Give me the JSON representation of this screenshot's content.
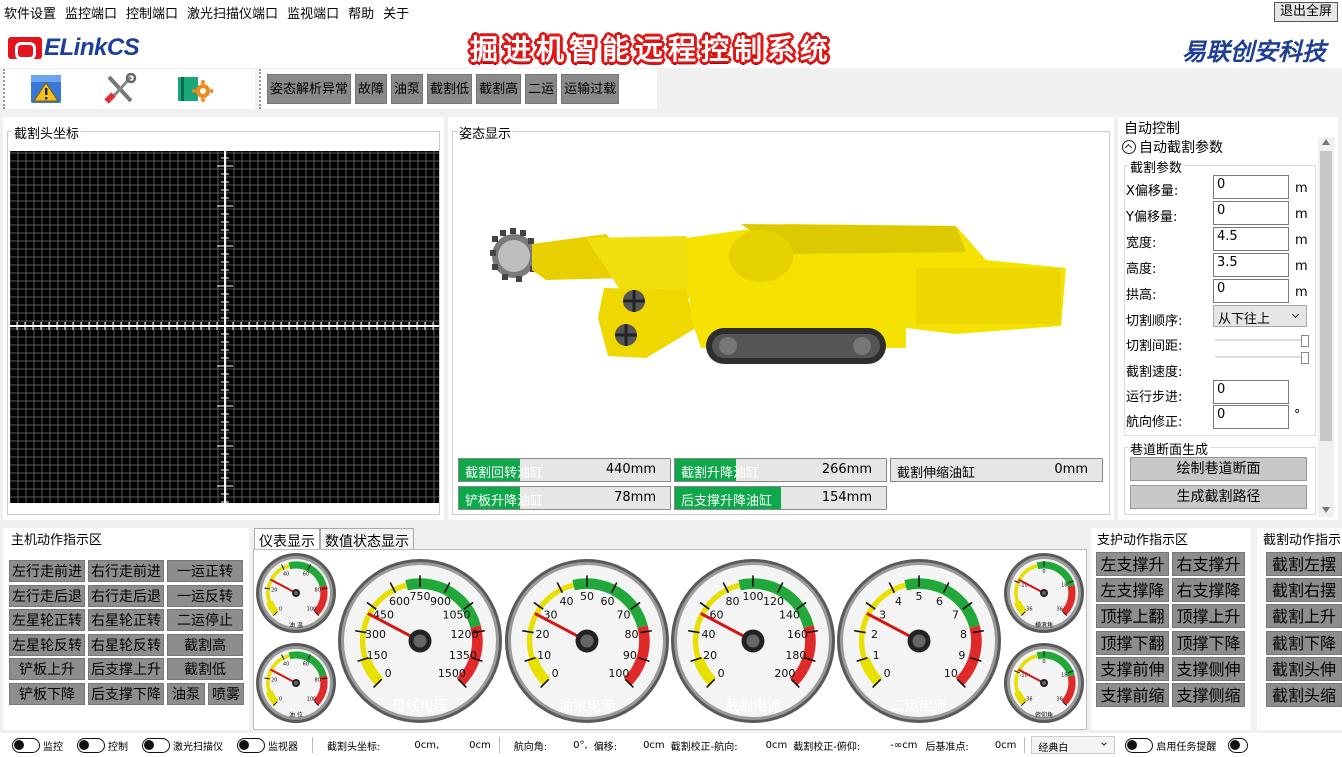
{
  "menu": [
    "软件设置",
    "监控端口",
    "控制端口",
    "激光扫描仪端口",
    "监视端口",
    "帮助",
    "关于"
  ],
  "exit_label": "退出全屏",
  "logo_text": "ELinkCS",
  "app_title": "掘进机智能远程控制系统",
  "brand": "易联创安科技",
  "toolbar_icons": [
    "warning-icon",
    "tools-icon",
    "book-gear-icon"
  ],
  "alarms": [
    "姿态解析异常",
    "故障",
    "油泵",
    "截割低",
    "截割高",
    "二运",
    "运输过载"
  ],
  "coord_panel_title": "截割头坐标",
  "attitude_panel_title": "姿态显示",
  "cylinders": [
    {
      "label": "截割回转油缸",
      "value": "440mm",
      "fill": 0.29
    },
    {
      "label": "截割升降油缸",
      "value": "266mm",
      "fill": 0.29
    },
    {
      "label": "截割伸缩油缸",
      "value": "0mm",
      "fill": 0
    },
    {
      "label": "铲板升降油缸",
      "value": "78mm",
      "fill": 0.29
    },
    {
      "label": "后支撑升降油缸",
      "value": "154mm",
      "fill": 0.5
    }
  ],
  "auto": {
    "title": "自动控制",
    "section": "自动截割参数",
    "group": "截割参数",
    "fields": [
      {
        "label": "X偏移量:",
        "value": "0",
        "unit": "m"
      },
      {
        "label": "Y偏移量:",
        "value": "0",
        "unit": "m"
      },
      {
        "label": "宽度:",
        "value": "4.5",
        "unit": "m"
      },
      {
        "label": "高度:",
        "value": "3.5",
        "unit": "m"
      },
      {
        "label": "拱高:",
        "value": "0",
        "unit": "m"
      }
    ],
    "order_label": "切割顺序:",
    "order_value": "从下往上",
    "spacing_label": "切割间距:",
    "speed_label": "截割速度:",
    "step_label": "运行步进:",
    "step_value": "0",
    "heading_label": "航向修正:",
    "heading_value": "0",
    "heading_unit": "°",
    "tunnel_group": "巷道断面生成",
    "draw_btn": "绘制巷道断面",
    "gen_btn": "生成截割路径"
  },
  "main_actions_title": "主机动作指示区",
  "main_actions": [
    [
      "左行走前进",
      "右行走前进",
      "一运正转"
    ],
    [
      "左行走后退",
      "右行走后退",
      "一运反转"
    ],
    [
      "左星轮正转",
      "右星轮正转",
      "二运停止"
    ],
    [
      "左星轮反转",
      "右星轮反转",
      "截割高"
    ],
    [
      "铲板上升",
      "后支撑上升",
      "截割低"
    ],
    [
      "铲板下降",
      "后支撑下降",
      "油泵",
      "喷雾"
    ]
  ],
  "tabs": [
    "仪表显示",
    "数值状态显示"
  ],
  "gauges_big": [
    {
      "label": "母线电压",
      "ticks": [
        "0",
        "150",
        "300",
        "450",
        "600",
        "750",
        "900",
        "1050",
        "1200",
        "1350",
        "1500"
      ],
      "value": 0
    },
    {
      "label": "油泵电流",
      "ticks": [
        "0",
        "10",
        "20",
        "30",
        "40",
        "50",
        "60",
        "70",
        "80",
        "90",
        "100"
      ],
      "value": 0
    },
    {
      "label": "截割电流",
      "ticks": [
        "0",
        "20",
        "40",
        "60",
        "80",
        "100",
        "120",
        "140",
        "160",
        "180",
        "200"
      ],
      "value": 0
    },
    {
      "label": "二运电流",
      "ticks": [
        "0",
        "1",
        "2",
        "3",
        "4",
        "5",
        "6",
        "7",
        "8",
        "9",
        "10"
      ],
      "value": 0
    }
  ],
  "gauges_small": [
    {
      "label": "油 温",
      "ticks": [
        "0",
        "20",
        "40",
        "60",
        "80",
        "100"
      ]
    },
    {
      "label": "油 位",
      "ticks": [
        "0",
        "20",
        "40",
        "60",
        "80",
        "100"
      ]
    },
    {
      "label": "横滚角",
      "ticks": [
        "-36",
        "-18",
        "0",
        "18",
        "36"
      ]
    },
    {
      "label": "俯仰角",
      "ticks": [
        "-36",
        "-18",
        "0",
        "18",
        "36"
      ]
    }
  ],
  "support_title": "支护动作指示区",
  "support_actions": [
    [
      "左支撑升",
      "右支撑升"
    ],
    [
      "左支撑降",
      "右支撑降"
    ],
    [
      "顶撑上翻",
      "顶撑上升"
    ],
    [
      "顶撑下翻",
      "顶撑下降"
    ],
    [
      "支撑前伸",
      "支撑侧伸"
    ],
    [
      "支撑前缩",
      "支撑侧缩"
    ]
  ],
  "cut_title": "截割动作指示",
  "cut_actions": [
    "截割左摆",
    "截割右摆",
    "截割上升",
    "截割下降",
    "截割头伸",
    "截割头缩"
  ],
  "status": {
    "toggles": [
      "监控",
      "控制",
      "激光扫描仪",
      "监视器"
    ],
    "coord_label": "截割头坐标:",
    "coord_x": "0cm,",
    "coord_y": "0cm",
    "heading": "航向角:",
    "heading_val": "0°,",
    "offset": "偏移:",
    "offset_val": "0cm",
    "corr_h": "截割校正-航向:",
    "corr_h_val": "0cm",
    "corr_p": "截割校正-俯仰:",
    "corr_p_val": "-∞cm",
    "ref": "后基准点:",
    "ref_val": "0cm",
    "theme": "经典白",
    "task": "启用任务提醒"
  }
}
